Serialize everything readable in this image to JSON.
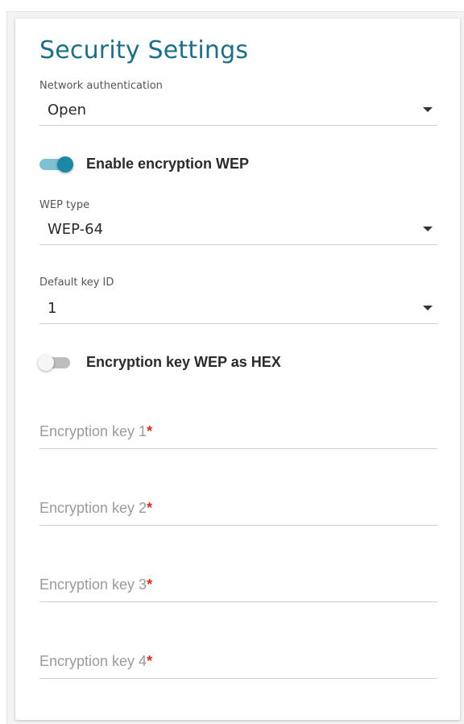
{
  "section": {
    "title": "Security Settings"
  },
  "network_authentication": {
    "label": "Network authentication",
    "value": "Open"
  },
  "encryption_toggle": {
    "label": "Enable encryption WEP",
    "enabled": true
  },
  "wep_type": {
    "label": "WEP type",
    "value": "WEP-64"
  },
  "default_key_id": {
    "label": "Default key ID",
    "value": "1"
  },
  "hex_toggle": {
    "label": "Encryption key WEP as HEX",
    "enabled": false
  },
  "encryption_keys": [
    {
      "placeholder": "Encryption key 1",
      "required_mark": "*",
      "value": ""
    },
    {
      "placeholder": "Encryption key 2",
      "required_mark": "*",
      "value": ""
    },
    {
      "placeholder": "Encryption key 3",
      "required_mark": "*",
      "value": ""
    },
    {
      "placeholder": "Encryption key 4",
      "required_mark": "*",
      "value": ""
    }
  ],
  "colors": {
    "title": "#1d6f87",
    "toggle_on_thumb": "#1b88a6",
    "toggle_on_track": "#7fc0d4",
    "required": "#d62f1f"
  },
  "icons": {
    "dropdown": "caret-down-icon"
  }
}
